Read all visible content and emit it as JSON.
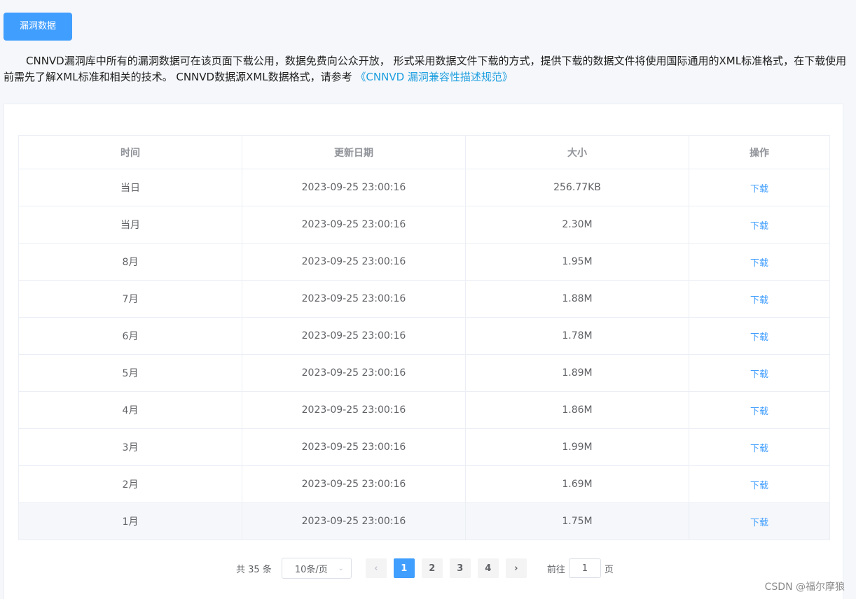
{
  "header": {
    "button_label": "漏洞数据"
  },
  "intro": {
    "text": "CNNVD漏洞库中所有的漏洞数据可在该页面下载公用，数据免费向公众开放， 形式采用数据文件下载的方式，提供下载的数据文件将使用国际通用的XML标准格式，在下载使用前需先了解XML标准和相关的技术。 CNNVD数据源XML数据格式，请参考 ",
    "link_text": "《CNNVD 漏洞兼容性描述规范》"
  },
  "table": {
    "columns": [
      "时间",
      "更新日期",
      "大小",
      "操作"
    ],
    "rows": [
      {
        "time": "当日",
        "date": "2023-09-25 23:00:16",
        "size": "256.77KB",
        "action": "下载"
      },
      {
        "time": "当月",
        "date": "2023-09-25 23:00:16",
        "size": "2.30M",
        "action": "下载"
      },
      {
        "time": "8月",
        "date": "2023-09-25 23:00:16",
        "size": "1.95M",
        "action": "下载"
      },
      {
        "time": "7月",
        "date": "2023-09-25 23:00:16",
        "size": "1.88M",
        "action": "下载"
      },
      {
        "time": "6月",
        "date": "2023-09-25 23:00:16",
        "size": "1.78M",
        "action": "下载"
      },
      {
        "time": "5月",
        "date": "2023-09-25 23:00:16",
        "size": "1.89M",
        "action": "下载"
      },
      {
        "time": "4月",
        "date": "2023-09-25 23:00:16",
        "size": "1.86M",
        "action": "下载"
      },
      {
        "time": "3月",
        "date": "2023-09-25 23:00:16",
        "size": "1.99M",
        "action": "下载"
      },
      {
        "time": "2月",
        "date": "2023-09-25 23:00:16",
        "size": "1.69M",
        "action": "下载"
      },
      {
        "time": "1月",
        "date": "2023-09-25 23:00:16",
        "size": "1.75M",
        "action": "下载"
      }
    ]
  },
  "pagination": {
    "total_text": "共 35 条",
    "page_size": "10条/页",
    "prev_icon": "‹",
    "next_icon": "›",
    "pages": [
      "1",
      "2",
      "3",
      "4"
    ],
    "current_page": "1",
    "goto_prefix": "前往",
    "goto_value": "1",
    "goto_suffix": "页"
  },
  "watermark": "CSDN @福尔摩狼",
  "colors": {
    "primary": "#409eff",
    "link": "#1e9fe0",
    "background": "#f5f7fa"
  }
}
